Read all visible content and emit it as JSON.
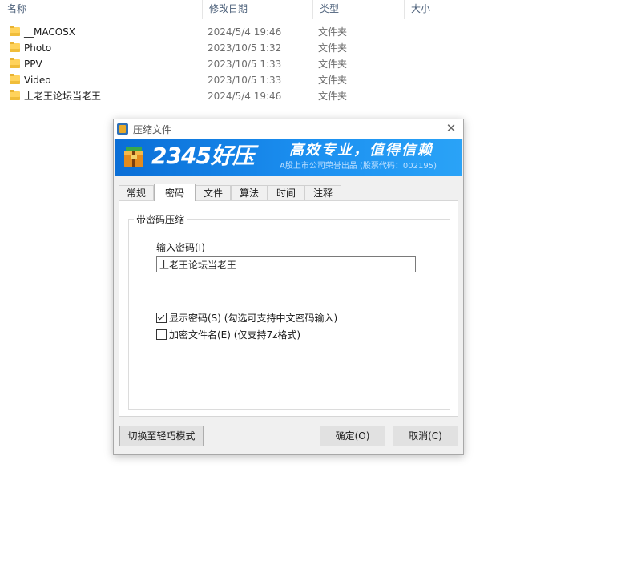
{
  "explorer": {
    "columns": {
      "name": "名称",
      "modified": "修改日期",
      "type": "类型",
      "size": "大小"
    },
    "sort_indicator": "^",
    "files": [
      {
        "name": "__MACOSX",
        "modified": "2024/5/4 19:46",
        "type": "文件夹"
      },
      {
        "name": "Photo",
        "modified": "2023/10/5 1:32",
        "type": "文件夹"
      },
      {
        "name": "PPV",
        "modified": "2023/10/5 1:33",
        "type": "文件夹"
      },
      {
        "name": "Video",
        "modified": "2023/10/5 1:33",
        "type": "文件夹"
      },
      {
        "name": "上老王论坛当老王",
        "modified": "2024/5/4 19:46",
        "type": "文件夹"
      }
    ]
  },
  "dialog": {
    "title": "压缩文件",
    "close_icon": "close-icon",
    "banner": {
      "brand": "2345好压",
      "slogan": "高效专业，值得信赖",
      "sub": "A股上市公司荣誉出品 (股票代码：002195)",
      "accent_color": "#1b8ff0"
    },
    "tabs": [
      {
        "label": "常规"
      },
      {
        "label": "密码"
      },
      {
        "label": "文件"
      },
      {
        "label": "算法"
      },
      {
        "label": "时间"
      },
      {
        "label": "注释"
      }
    ],
    "active_tab": "密码",
    "group_title": "带密码压缩",
    "password_label": "输入密码(I)",
    "password_value": "上老王论坛当老王",
    "show_password": {
      "label": "显示密码(S) (勾选可支持中文密码输入)",
      "checked": true
    },
    "encrypt_names": {
      "label": "加密文件名(E) (仅支持7z格式)",
      "checked": false
    },
    "buttons": {
      "switch_mode": "切换至轻巧模式",
      "ok": "确定(O)",
      "cancel": "取消(C)"
    }
  }
}
